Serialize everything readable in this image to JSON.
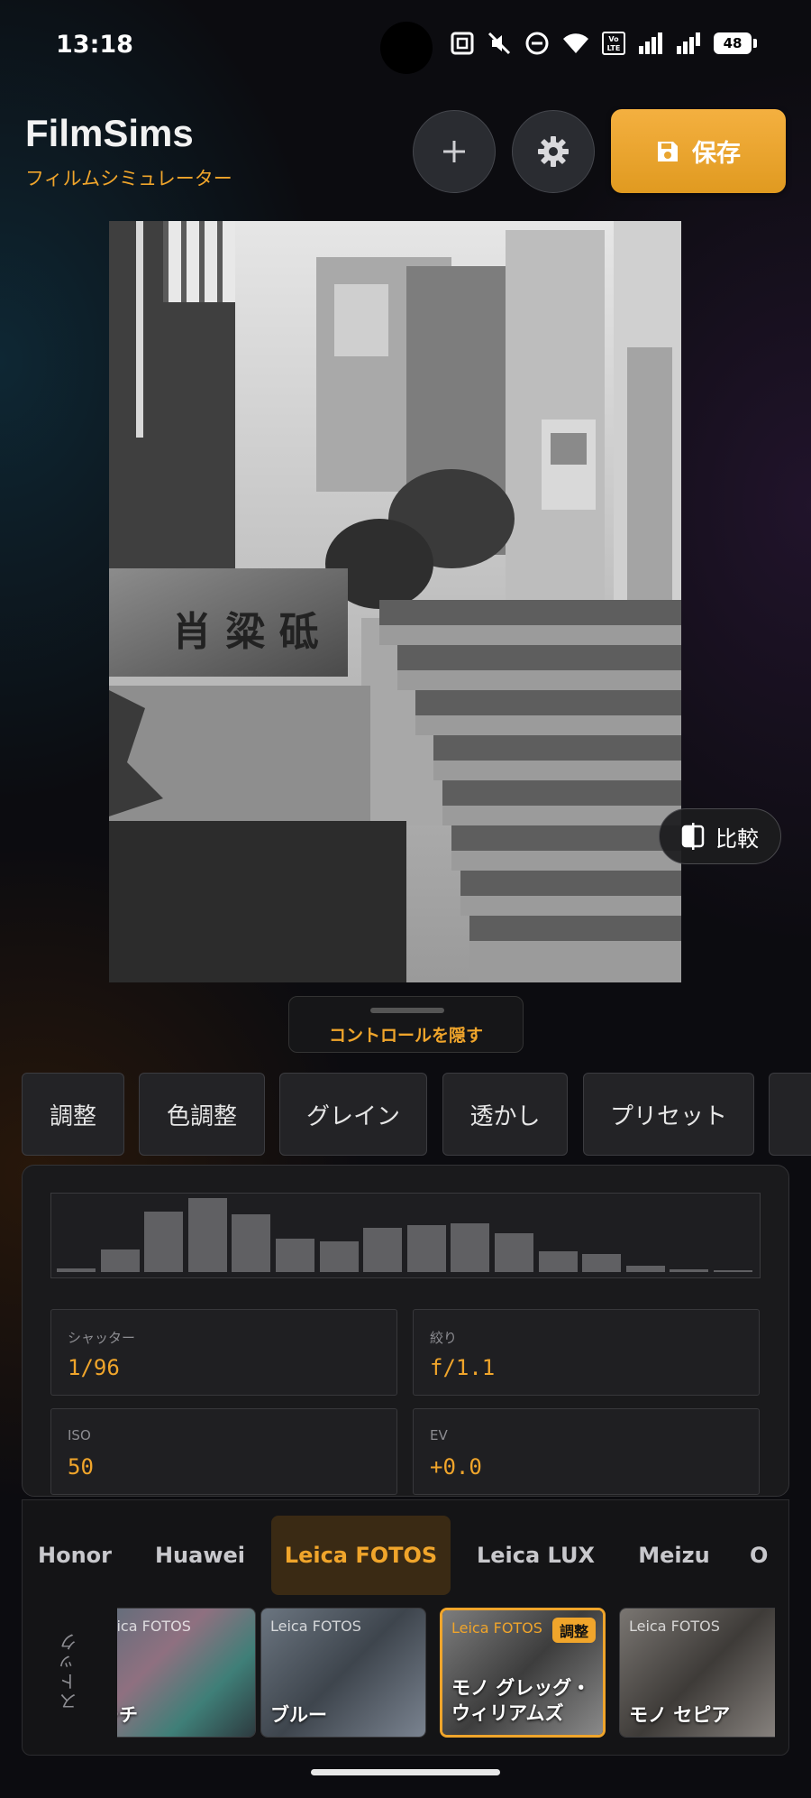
{
  "status_bar": {
    "time": "13:18",
    "battery": "48",
    "icons": [
      "nfc-icon",
      "mute-icon",
      "dnd-icon",
      "wifi-icon",
      "volte-icon",
      "signal-icon",
      "signal-roaming-icon",
      "battery-icon"
    ],
    "volte_text": "Vo LTE"
  },
  "header": {
    "title": "FilmSims",
    "subtitle": "フィルムシミュレーター",
    "add_icon": "plus-icon",
    "settings_icon": "gear-icon",
    "save_label": "保存",
    "save_icon": "floppy-disk-icon"
  },
  "preview": {
    "compare_label": "比較",
    "compare_icon": "compare-split-icon",
    "hide_controls_label": "コントロールを隠す"
  },
  "tabs": [
    "調整",
    "色調整",
    "グレイン",
    "透かし",
    "プリセット"
  ],
  "histogram": {
    "levels": [
      0.05,
      0.3,
      0.82,
      1.0,
      0.78,
      0.45,
      0.42,
      0.6,
      0.64,
      0.66,
      0.52,
      0.28,
      0.24,
      0.08,
      0.04,
      0.02
    ]
  },
  "exif": {
    "shutter_label": "シャッター",
    "shutter_value": "1/96",
    "aperture_label": "絞り",
    "aperture_value": "f/1.1",
    "iso_label": "ISO",
    "iso_value": "50",
    "ev_label": "EV",
    "ev_value": "+0.0"
  },
  "brands": {
    "items": [
      "Honor",
      "Huawei",
      "Leica FOTOS",
      "Leica LUX",
      "Meizu",
      "O"
    ],
    "active": "Leica FOTOS",
    "category_label": "ストック"
  },
  "presets": [
    {
      "brand": "Leica FOTOS",
      "name": "ーチ",
      "badge": "",
      "selected": false
    },
    {
      "brand": "Leica FOTOS",
      "name": "ブルー",
      "badge": "",
      "selected": false
    },
    {
      "brand": "Leica FOTOS",
      "name": "モノ グレッグ・ウィリアムズ",
      "name_line1": "モノ グレッグ・",
      "name_line2": "ウィリアムズ",
      "badge": "調整",
      "selected": true
    },
    {
      "brand": "Leica FOTOS",
      "name": "モノ セピア",
      "badge": "",
      "selected": false
    }
  ],
  "colors": {
    "accent": "#f0a52b",
    "background": "#0c0c10",
    "panel": "#1a1a1c"
  }
}
